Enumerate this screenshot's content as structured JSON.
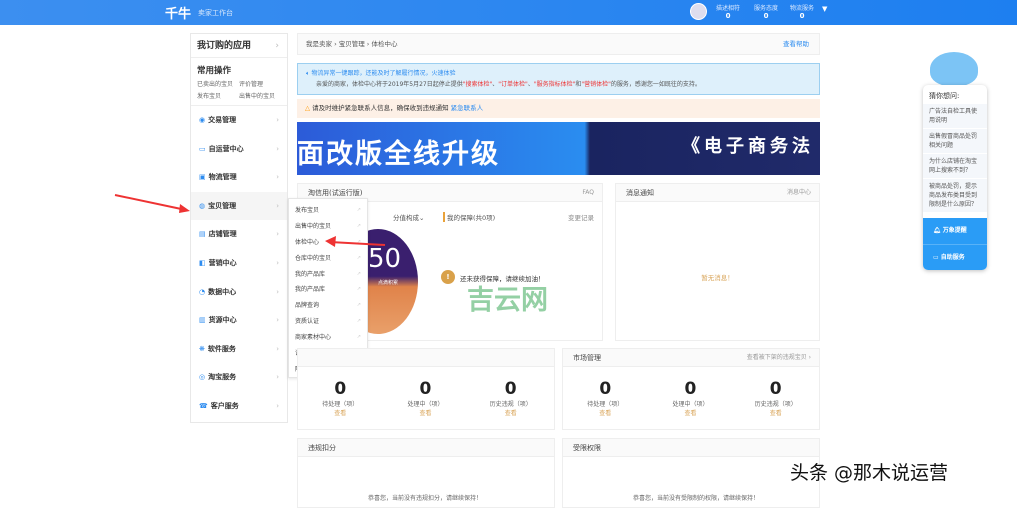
{
  "header": {
    "logo": "千牛",
    "subtitle": "卖家工作台",
    "stats": [
      {
        "label": "描述相符",
        "value": "0"
      },
      {
        "label": "服务态度",
        "value": "0"
      },
      {
        "label": "物流服务",
        "value": "0"
      }
    ]
  },
  "sidebar": {
    "title": "我订购的应用",
    "common_title": "常用操作",
    "common_links": [
      "已卖出的宝贝",
      "评价管理",
      "发布宝贝",
      "出售中的宝贝"
    ],
    "items": [
      {
        "label": "交易管理",
        "icon": "◉"
      },
      {
        "label": "自运营中心",
        "icon": "▭"
      },
      {
        "label": "物流管理",
        "icon": "▣"
      },
      {
        "label": "宝贝管理",
        "icon": "◍"
      },
      {
        "label": "店铺管理",
        "icon": "▤"
      },
      {
        "label": "营销中心",
        "icon": "◧"
      },
      {
        "label": "数据中心",
        "icon": "◔"
      },
      {
        "label": "货源中心",
        "icon": "▥"
      },
      {
        "label": "软件服务",
        "icon": "❋"
      },
      {
        "label": "淘宝服务",
        "icon": "◎"
      },
      {
        "label": "客户服务",
        "icon": "☎"
      }
    ]
  },
  "submenu": [
    "发布宝贝",
    "出售中的宝贝",
    "体检中心",
    "仓库中的宝贝",
    "我的产品库",
    "我的产品库",
    "品牌查询",
    "资质认证",
    "商家素材中心",
    "详情装修",
    "阿里图片"
  ],
  "breadcrumb": {
    "items": [
      "我是卖家",
      "宝贝管理",
      "体检中心"
    ],
    "help": "查看帮助"
  },
  "notice": {
    "line1": "物流异常一键跟踪，还能及时了解履行情况，火速体验",
    "line2_a": "亲爱的商家，体检中心将于2019年5月27日起停止提供",
    "t1": "\"搜索体检\"",
    "t2": "\"订单体检\"",
    "t3": "\"服务指标体检\"",
    "t4": "\"营销体检\"",
    "line2_b": "的服务，感谢您一如既往的支持。",
    "and": "和",
    "sep": "、"
  },
  "warning": {
    "text": "请及时维护紧急联系人信息，确保收到违规通知",
    "link": "紧急联系人"
  },
  "banner": {
    "left": "面改版全线升级",
    "right": "《电子商务法"
  },
  "credit": {
    "title": "淘信用(试运行版)",
    "faq": "FAQ",
    "tab": "分值构成",
    "guarantee": "我的保障(共0项)",
    "changes": "变更记录",
    "score": "50",
    "score_label": "点滴积累",
    "empty": "还未获得保障，请继续加油！"
  },
  "messages": {
    "title": "消息通知",
    "link": "消息中心",
    "empty": "暂无消息！"
  },
  "counts_labels": [
    "待处理（项）",
    "处理中（项）",
    "历史违规（项）"
  ],
  "view": "查看",
  "left_counts": [
    "0",
    "0",
    "0"
  ],
  "market": {
    "title": "市场管理",
    "link": "查看被下架的违规宝贝 ›",
    "counts": [
      "0",
      "0",
      "0"
    ]
  },
  "deduct": {
    "title": "违规扣分",
    "text": "恭喜您，当前没有违规扣分，请继续保持！"
  },
  "restrict": {
    "title": "受限权限",
    "text": "恭喜您，当前没有受限制的权限，请继续保持！"
  },
  "widget": {
    "title": "猜你想问:",
    "questions": [
      "广告法自检工具使用说明",
      "出售假冒商品处罚相关问题",
      "为什么店铺在淘宝网上搜索不到？",
      "被商品处罚，提示商品发布类目受到限制是什么原因？"
    ],
    "btn1": "万象提醒",
    "btn2": "自助服务"
  },
  "watermarks": {
    "center": "吉云网",
    "corner": "头条 @那木说运营"
  }
}
